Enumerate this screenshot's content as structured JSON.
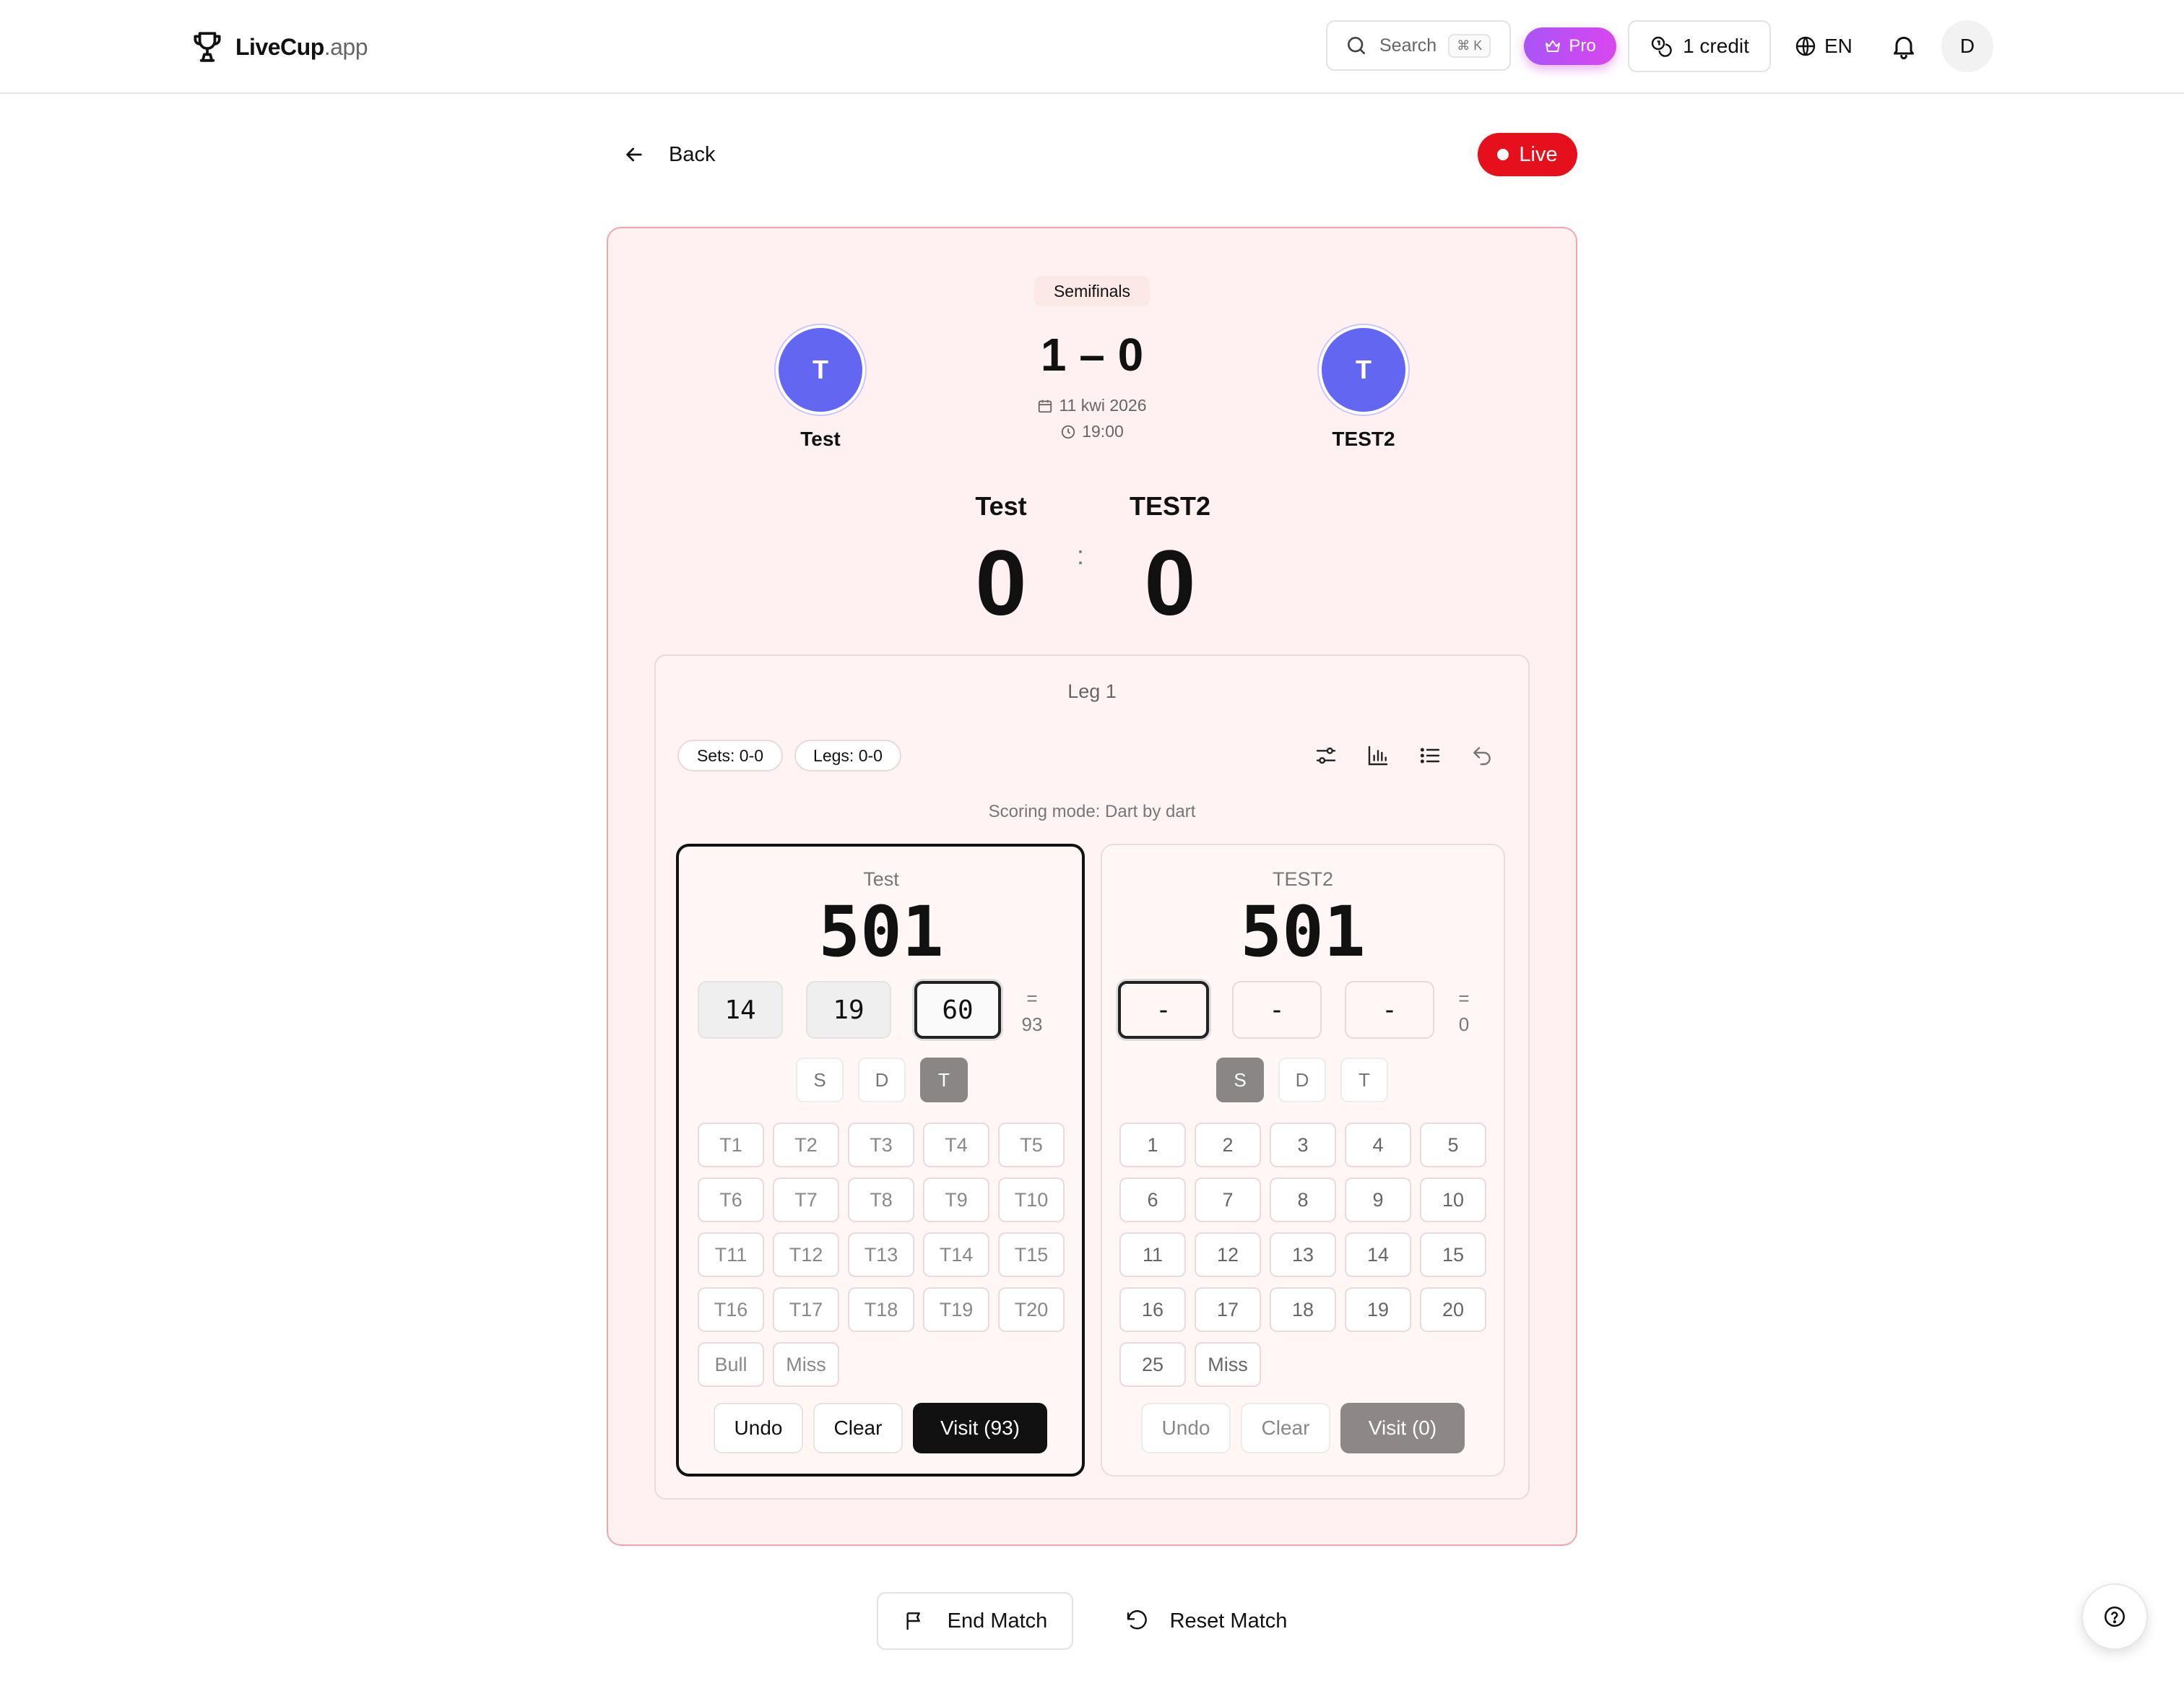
{
  "brand": {
    "name": "LiveCup",
    "suffix": ".app"
  },
  "nav": {
    "search_label": "Search",
    "search_kbd": "⌘ K",
    "pro_label": "Pro",
    "credit_label": "1 credit",
    "language": "EN",
    "user_initial": "D"
  },
  "page": {
    "back_label": "Back",
    "live_label": "Live"
  },
  "match": {
    "stage": "Semifinals",
    "score": "1 – 0",
    "date": "11 kwi 2026",
    "time": "19:00",
    "home": {
      "initial": "T",
      "name": "Test"
    },
    "away": {
      "initial": "T",
      "name": "TEST2"
    }
  },
  "live_score": {
    "home_name": "Test",
    "away_name": "TEST2",
    "home_score": "0",
    "away_score": "0",
    "separator": ":"
  },
  "leg": {
    "title": "Leg 1",
    "sets": "Sets: 0-0",
    "legs": "Legs: 0-0",
    "mode": "Scoring mode: Dart by dart"
  },
  "players": [
    {
      "name": "Test",
      "remaining": "501",
      "darts": [
        "14",
        "19",
        "60"
      ],
      "sum_sign": "=",
      "sum": "93",
      "multipliers": [
        "S",
        "D",
        "T"
      ],
      "selected_multiplier": "T",
      "keys": [
        "T1",
        "T2",
        "T3",
        "T4",
        "T5",
        "T6",
        "T7",
        "T8",
        "T9",
        "T10",
        "T11",
        "T12",
        "T13",
        "T14",
        "T15",
        "T16",
        "T17",
        "T18",
        "T19",
        "T20",
        "Bull",
        "Miss"
      ],
      "undo": "Undo",
      "clear": "Clear",
      "visit": "Visit (93)"
    },
    {
      "name": "TEST2",
      "remaining": "501",
      "darts": [
        "-",
        "-",
        "-"
      ],
      "sum_sign": "=",
      "sum": "0",
      "multipliers": [
        "S",
        "D",
        "T"
      ],
      "selected_multiplier": "S",
      "keys": [
        "1",
        "2",
        "3",
        "4",
        "5",
        "6",
        "7",
        "8",
        "9",
        "10",
        "11",
        "12",
        "13",
        "14",
        "15",
        "16",
        "17",
        "18",
        "19",
        "20",
        "25",
        "Miss"
      ],
      "undo": "Undo",
      "clear": "Clear",
      "visit": "Visit (0)"
    }
  ],
  "footer": {
    "end_match": "End Match",
    "reset_match": "Reset Match"
  },
  "colors": {
    "live": "#e5101b",
    "pro_start": "#a855f7",
    "pro_end": "#d946ef",
    "team_avatar": "#6366f1",
    "card_border": "#f3a5ad",
    "card_bg": "#fff1f1"
  }
}
